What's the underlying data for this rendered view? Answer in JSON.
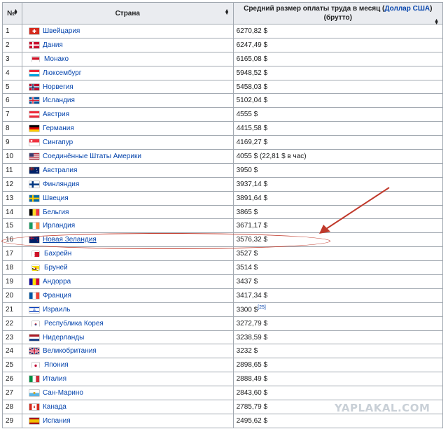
{
  "header": {
    "num": "№",
    "country": "Страна",
    "salary_part1": "Средний размер оплаты труда в месяц (",
    "salary_link": "Доллар США",
    "salary_part2": ")",
    "salary_part3": "(брутто)"
  },
  "rows": [
    {
      "n": "1",
      "country": "Швейцария",
      "value": "6270,82 $",
      "flag": "ch"
    },
    {
      "n": "2",
      "country": "Дания",
      "value": "6247,49 $",
      "flag": "dk"
    },
    {
      "n": "3",
      "country": "Монако",
      "value": "6165,08 $",
      "flag": "mc"
    },
    {
      "n": "4",
      "country": "Люксембург",
      "value": "5948,52 $",
      "flag": "lu"
    },
    {
      "n": "5",
      "country": "Норвегия",
      "value": "5458,03 $",
      "flag": "no"
    },
    {
      "n": "6",
      "country": "Исландия",
      "value": "5102,04 $",
      "flag": "is"
    },
    {
      "n": "7",
      "country": "Австрия",
      "value": "4555 $",
      "flag": "at"
    },
    {
      "n": "8",
      "country": "Германия",
      "value": "4415,58 $",
      "flag": "de"
    },
    {
      "n": "9",
      "country": "Сингапур",
      "value": "4169,27 $",
      "flag": "sg"
    },
    {
      "n": "10",
      "country": "Соединённые Штаты Америки",
      "value": "4055 $ (22,81 $ в час)",
      "flag": "us"
    },
    {
      "n": "11",
      "country": "Австралия",
      "value": "3950 $",
      "flag": "au"
    },
    {
      "n": "12",
      "country": "Финляндия",
      "value": "3937,14 $",
      "flag": "fi"
    },
    {
      "n": "13",
      "country": "Швеция",
      "value": "3891,64 $",
      "flag": "se"
    },
    {
      "n": "14",
      "country": "Бельгия",
      "value": "3865 $",
      "flag": "be"
    },
    {
      "n": "15",
      "country": "Ирландия",
      "value": "3671,17 $",
      "flag": "ie"
    },
    {
      "n": "16",
      "country": "Новая Зеландия",
      "value": "3576,32 $",
      "flag": "nz"
    },
    {
      "n": "17",
      "country": "Бахрейн",
      "value": "3527 $",
      "flag": "bh"
    },
    {
      "n": "18",
      "country": "Бруней",
      "value": "3514 $",
      "flag": "bn"
    },
    {
      "n": "19",
      "country": "Андорра",
      "value": "3437 $",
      "flag": "ad"
    },
    {
      "n": "20",
      "country": "Франция",
      "value": "3417,34 $",
      "flag": "fr"
    },
    {
      "n": "21",
      "country": "Израиль",
      "value": "3300 $",
      "flag": "il",
      "sup": "[25]"
    },
    {
      "n": "22",
      "country": "Республика Корея",
      "value": "3272,79 $",
      "flag": "kr"
    },
    {
      "n": "23",
      "country": "Нидерланды",
      "value": "3238,59 $",
      "flag": "nl"
    },
    {
      "n": "24",
      "country": "Великобритания",
      "value": "3232 $",
      "flag": "gb"
    },
    {
      "n": "25",
      "country": "Япония",
      "value": "2898,65 $",
      "flag": "jp"
    },
    {
      "n": "26",
      "country": "Италия",
      "value": "2888,49 $",
      "flag": "it"
    },
    {
      "n": "27",
      "country": "Сан-Марино",
      "value": "2843,60 $",
      "flag": "sm"
    },
    {
      "n": "28",
      "country": "Канада",
      "value": "2785,79 $",
      "flag": "ca"
    },
    {
      "n": "29",
      "country": "Испания",
      "value": "2495,62 $",
      "flag": "es"
    }
  ],
  "watermark": "YAPLAKAL.COM",
  "colors": {
    "link": "#0645ad",
    "header_bg": "#eaecf0",
    "border": "#a2a9b1",
    "annotation": "#c0392b"
  }
}
